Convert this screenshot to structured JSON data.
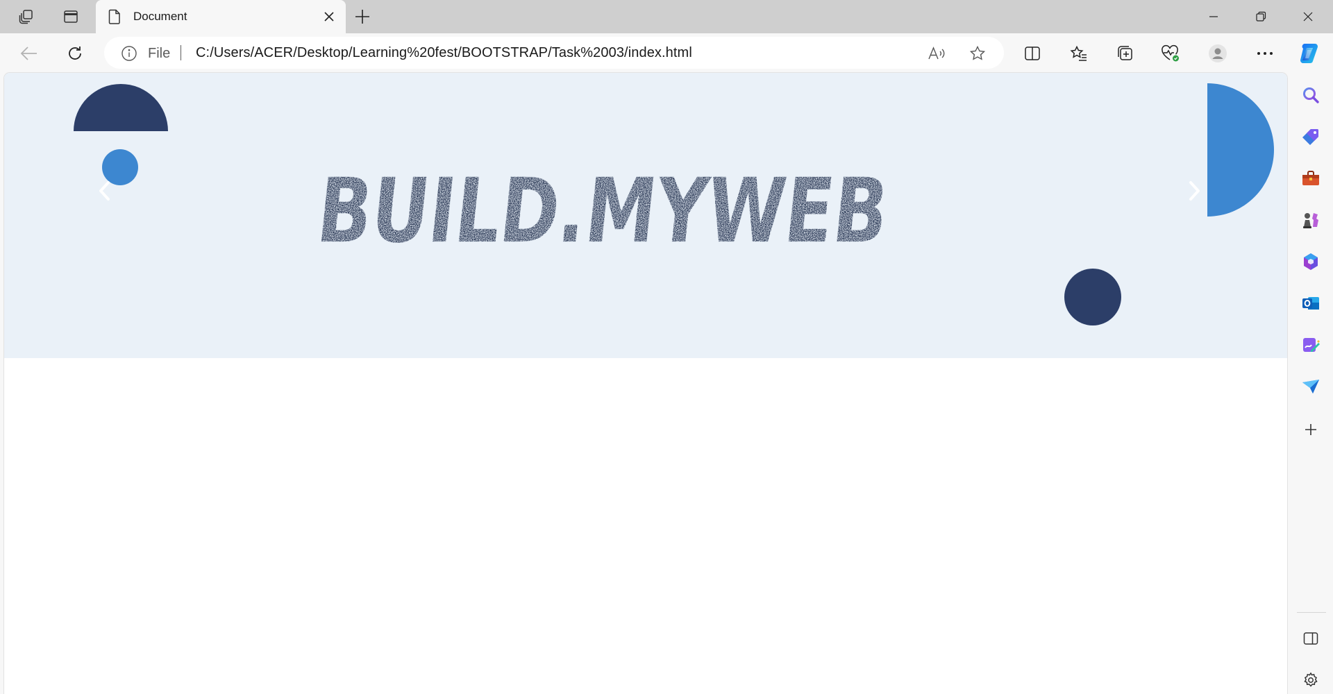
{
  "tab": {
    "title": "Document"
  },
  "toolbar": {
    "site_info_label": "File",
    "url": "C:/Users/ACER/Desktop/Learning%20fest/BOOTSTRAP/Task%2003/index.html"
  },
  "page": {
    "brand_text": "BUILD.MYWEB",
    "colors": {
      "banner_bg": "#eaf1f8",
      "navy": "#2c3e68",
      "blue": "#3d87d0",
      "brand_text": "#172545"
    }
  },
  "sidebar": {
    "items": [
      "search-icon",
      "shopping-tag-icon",
      "tools-icon",
      "games-icon",
      "office-icon",
      "outlook-icon",
      "designer-icon",
      "send-icon",
      "add-icon"
    ]
  }
}
